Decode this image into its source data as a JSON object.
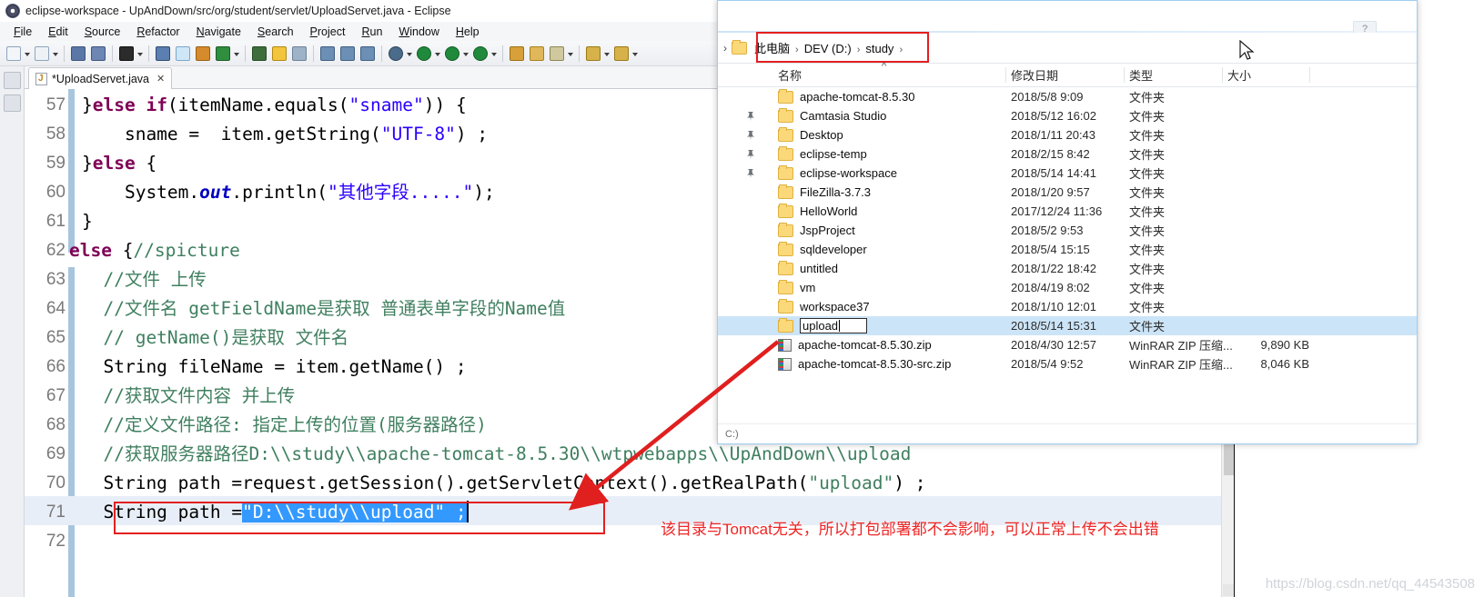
{
  "eclipse": {
    "title": "eclipse-workspace - UpAndDown/src/org/student/servlet/UploadServet.java - Eclipse",
    "window_controls": {
      "minimize": "—",
      "maximize": "❐",
      "close": "✕"
    },
    "menu": [
      "File",
      "Edit",
      "Source",
      "Refactor",
      "Navigate",
      "Search",
      "Project",
      "Run",
      "Window",
      "Help"
    ],
    "tab": {
      "label": "*UploadServet.java",
      "close": "✕"
    },
    "code_lines": [
      {
        "no": "57",
        "indent": 0,
        "tokens": [
          {
            "t": "}",
            "c": "t"
          },
          {
            "t": "else ",
            "c": "k"
          },
          {
            "t": "if",
            "c": "k"
          },
          {
            "t": "(itemName.equals(",
            "c": "t"
          },
          {
            "t": "\"sname\"",
            "c": "s"
          },
          {
            "t": ")) {",
            "c": "t"
          }
        ]
      },
      {
        "no": "58",
        "indent": 0,
        "tokens": [
          {
            "t": "    sname =  item.getString(",
            "c": "t"
          },
          {
            "t": "\"UTF-8\"",
            "c": "s"
          },
          {
            "t": ") ;",
            "c": "t"
          }
        ]
      },
      {
        "no": "59",
        "indent": 0,
        "tokens": [
          {
            "t": "}",
            "c": "t"
          },
          {
            "t": "else",
            "c": "k"
          },
          {
            "t": " {",
            "c": "t"
          }
        ]
      },
      {
        "no": "60",
        "indent": 0,
        "tokens": [
          {
            "t": "    System.",
            "c": "t"
          },
          {
            "t": "out",
            "c": "f"
          },
          {
            "t": ".println(",
            "c": "t"
          },
          {
            "t": "\"其他字段.....\"",
            "c": "s"
          },
          {
            "t": ");",
            "c": "t"
          }
        ]
      },
      {
        "no": "61",
        "indent": 0,
        "tokens": [
          {
            "t": "}",
            "c": "t"
          }
        ]
      },
      {
        "no": "62",
        "indent": -14,
        "tokens": [
          {
            "t": "else",
            "c": "k"
          },
          {
            "t": " {",
            "c": "t"
          },
          {
            "t": "//spicture",
            "c": "c"
          }
        ]
      },
      {
        "no": "63",
        "indent": 0,
        "tokens": [
          {
            "t": "  //文件 上传",
            "c": "c"
          }
        ]
      },
      {
        "no": "64",
        "indent": 0,
        "tokens": [
          {
            "t": "  //文件名 getFieldName是获取 普通表单字段的Name值",
            "c": "c"
          }
        ]
      },
      {
        "no": "65",
        "indent": 0,
        "tokens": [
          {
            "t": "  // getName()是获取 文件名",
            "c": "c"
          }
        ]
      },
      {
        "no": "66",
        "indent": 0,
        "tokens": [
          {
            "t": "  String fileName = item.getName() ;",
            "c": "t"
          }
        ]
      },
      {
        "no": "67",
        "indent": 0,
        "tokens": [
          {
            "t": "  //获取文件内容 并上传",
            "c": "c"
          }
        ]
      },
      {
        "no": "68",
        "indent": 0,
        "tokens": [
          {
            "t": "  //定义文件路径: 指定上传的位置(服务器路径)",
            "c": "c"
          }
        ]
      },
      {
        "no": "69",
        "indent": 0,
        "tokens": [
          {
            "t": "  //获取服务器路径D:\\\\study\\\\apache-tomcat-8.5.30\\\\wtpwebapps\\\\UpAndDown\\\\upload",
            "c": "c"
          }
        ]
      },
      {
        "no": "70",
        "indent": 0,
        "tokens": [
          {
            "t": "  String path =request.getSession().getServletContext().getRealPath(",
            "c": "t"
          },
          {
            "t": "\"upload\"",
            "c": "c"
          },
          {
            "t": ") ;",
            "c": "t"
          }
        ]
      },
      {
        "no": "71",
        "indent": 0,
        "highlight": true,
        "tokens": [
          {
            "t": "  String path =",
            "c": "t"
          },
          {
            "t": "\"D:\\\\study\\\\upload\" ;",
            "c": "sel"
          }
        ]
      },
      {
        "no": "72",
        "indent": 0,
        "tokens": []
      }
    ],
    "annotation": "该目录与Tomcat无关，所以打包部署都不会影响，可以正常上传不会出错",
    "annotation_color": "#ef2424",
    "highlight_box_color": "#e41f1f"
  },
  "explorer": {
    "window_controls": {
      "minimize": "—",
      "maximize": "❐",
      "close": "✕"
    },
    "help_glyph": "?",
    "breadcrumb": [
      "此电脑",
      "DEV (D:)",
      "study"
    ],
    "breadcrumb_sep": "›",
    "columns": [
      "名称",
      "修改日期",
      "类型",
      "大小"
    ],
    "sort_indicator": "^",
    "rows": [
      {
        "name": "apache-tomcat-8.5.30",
        "date": "2018/5/8 9:09",
        "type": "文件夹",
        "size": "",
        "icon": "folder-icon",
        "pinned": false
      },
      {
        "name": "Camtasia Studio",
        "date": "2018/5/12 16:02",
        "type": "文件夹",
        "size": "",
        "icon": "folder-icon",
        "pinned": true
      },
      {
        "name": "Desktop",
        "date": "2018/1/11 20:43",
        "type": "文件夹",
        "size": "",
        "icon": "folder-icon",
        "pinned": true
      },
      {
        "name": "eclipse-temp",
        "date": "2018/2/15 8:42",
        "type": "文件夹",
        "size": "",
        "icon": "folder-icon",
        "pinned": true
      },
      {
        "name": "eclipse-workspace",
        "date": "2018/5/14 14:41",
        "type": "文件夹",
        "size": "",
        "icon": "folder-icon",
        "pinned": true
      },
      {
        "name": "FileZilla-3.7.3",
        "date": "2018/1/20 9:57",
        "type": "文件夹",
        "size": "",
        "icon": "folder-icon",
        "pinned": false
      },
      {
        "name": "HelloWorld",
        "date": "2017/12/24 11:36",
        "type": "文件夹",
        "size": "",
        "icon": "folder-icon",
        "pinned": false
      },
      {
        "name": "JspProject",
        "date": "2018/5/2 9:53",
        "type": "文件夹",
        "size": "",
        "icon": "folder-icon",
        "pinned": false
      },
      {
        "name": "sqldeveloper",
        "date": "2018/5/4 15:15",
        "type": "文件夹",
        "size": "",
        "icon": "folder-icon",
        "pinned": false
      },
      {
        "name": "untitled",
        "date": "2018/1/22 18:42",
        "type": "文件夹",
        "size": "",
        "icon": "folder-icon",
        "pinned": false
      },
      {
        "name": "vm",
        "date": "2018/4/19 8:02",
        "type": "文件夹",
        "size": "",
        "icon": "folder-icon",
        "pinned": false
      },
      {
        "name": "workspace37",
        "date": "2018/1/10 12:01",
        "type": "文件夹",
        "size": "",
        "icon": "folder-icon",
        "pinned": false
      },
      {
        "name": "upload",
        "date": "2018/5/14 15:31",
        "type": "文件夹",
        "size": "",
        "icon": "folder-icon",
        "pinned": false,
        "selected": true,
        "renaming": true
      },
      {
        "name": "apache-tomcat-8.5.30.zip",
        "date": "2018/4/30 12:57",
        "type": "WinRAR ZIP 压缩...",
        "size": "9,890 KB",
        "icon": "zip-icon",
        "pinned": false
      },
      {
        "name": "apache-tomcat-8.5.30-src.zip",
        "date": "2018/5/4 9:52",
        "type": "WinRAR ZIP 压缩...",
        "size": "8,046 KB",
        "icon": "zip-icon",
        "pinned": false
      }
    ],
    "status_text": "C:)",
    "breadcrumb_box_color": "#e41f1f",
    "selection_color": "#cce4f7"
  },
  "watermark": "https://blog.csdn.net/qq_44543508",
  "cursor": {
    "type": "arrow-pointer"
  }
}
